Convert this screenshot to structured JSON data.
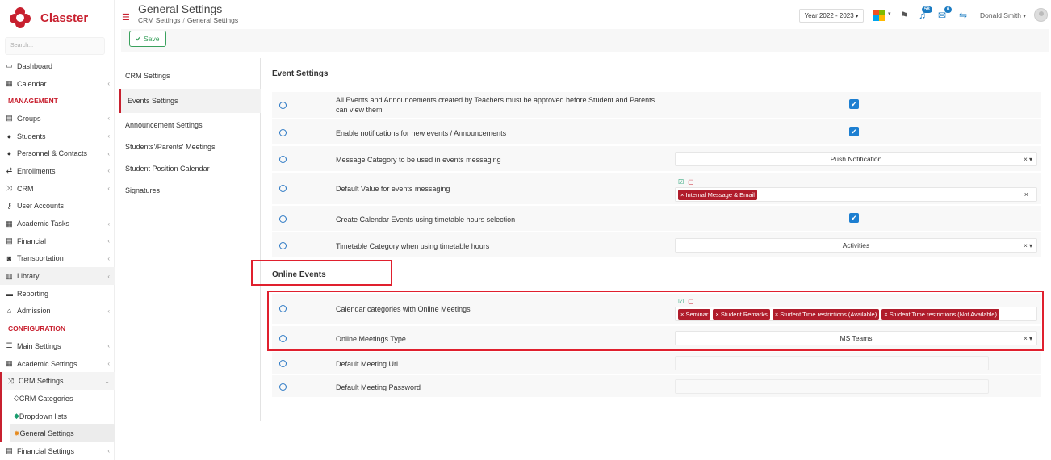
{
  "app": {
    "name": "Classter"
  },
  "sidebar": {
    "search_placeholder": "Search...",
    "items": [
      {
        "label": "Dashboard",
        "icon": "monitor-icon"
      },
      {
        "label": "Calendar",
        "icon": "calendar-icon"
      },
      {
        "section": "MANAGEMENT"
      },
      {
        "label": "Groups",
        "icon": "groups-icon"
      },
      {
        "label": "Students",
        "icon": "students-icon"
      },
      {
        "label": "Personnel & Contacts",
        "icon": "personnel-icon"
      },
      {
        "label": "Enrollments",
        "icon": "enrollments-icon"
      },
      {
        "label": "CRM",
        "icon": "crm-icon"
      },
      {
        "label": "User Accounts",
        "icon": "key-icon"
      },
      {
        "label": "Academic Tasks",
        "icon": "tasks-icon"
      },
      {
        "label": "Financial",
        "icon": "financial-icon"
      },
      {
        "label": "Transportation",
        "icon": "bus-icon"
      },
      {
        "label": "Library",
        "icon": "library-icon"
      },
      {
        "label": "Reporting",
        "icon": "printer-icon"
      },
      {
        "label": "Admission",
        "icon": "admission-icon"
      },
      {
        "section": "CONFIGURATION"
      },
      {
        "label": "Main Settings",
        "icon": "settings-icon"
      },
      {
        "label": "Academic Settings",
        "icon": "academic-icon"
      },
      {
        "label": "CRM Settings",
        "icon": "crm-icon"
      },
      {
        "label": "CRM Categories",
        "icon": "tags-icon",
        "sub": true
      },
      {
        "label": "Dropdown lists",
        "icon": "layers-icon",
        "sub": true
      },
      {
        "label": "General Settings",
        "icon": "gear-icon",
        "sub": true
      },
      {
        "label": "Financial Settings",
        "icon": "financial-icon"
      }
    ]
  },
  "header": {
    "title": "General Settings",
    "breadcrumb": [
      "CRM Settings",
      "General Settings"
    ],
    "year": "Year 2022 - 2023",
    "notifications_count": "58",
    "messages_count": "6",
    "user_name": "Donald Smith"
  },
  "toolbar": {
    "save_label": "Save"
  },
  "settings_menu": [
    "CRM Settings",
    "Events Settings",
    "Announcement Settings",
    "Students'/Parents' Meetings",
    "Student Position Calendar",
    "Signatures"
  ],
  "event_settings": {
    "title": "Event Settings",
    "rows": [
      {
        "label": "All Events and Announcements created by Teachers must be approved before Student and Parents can view them"
      },
      {
        "label": "Enable notifications for new events / Announcements"
      },
      {
        "label": "Message Category to be used in events messaging",
        "value": "Push Notification"
      },
      {
        "label": "Default Value for events messaging",
        "tags": [
          "Internal Message & Email"
        ]
      },
      {
        "label": "Create Calendar Events using timetable hours selection"
      },
      {
        "label": "Timetable Category when using timetable hours",
        "value": "Activities"
      }
    ]
  },
  "online_events": {
    "title": "Online Events",
    "rows": [
      {
        "label": "Calendar categories with Online Meetings",
        "tags": [
          "Seminar",
          "Student Remarks",
          "Student Time restrictions (Available)",
          "Student Time restrictions (Not Available)"
        ]
      },
      {
        "label": "Online Meetings Type",
        "value": "MS Teams"
      },
      {
        "label": "Default Meeting Url"
      },
      {
        "label": "Default Meeting Password"
      }
    ]
  },
  "colors": {
    "brand": "#c8202f",
    "accent": "#1d7fd1",
    "success": "#3aa15d"
  }
}
